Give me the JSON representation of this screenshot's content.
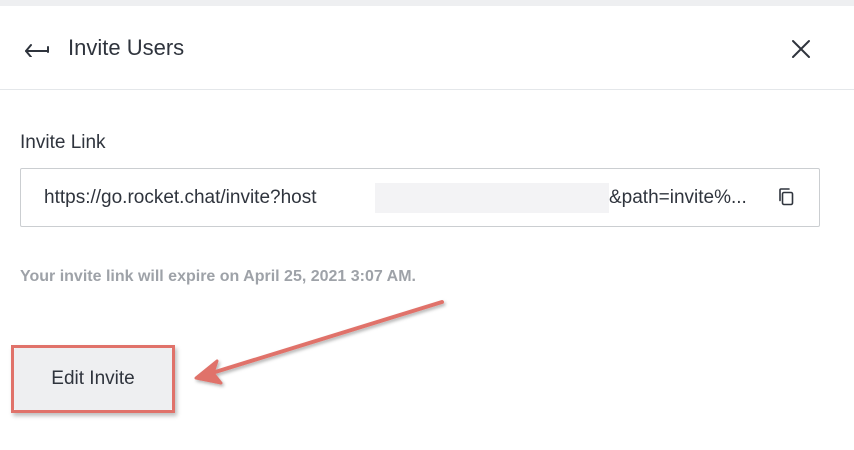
{
  "header": {
    "title": "Invite Users",
    "back_icon": "back-arrow-icon",
    "close_icon": "close-icon"
  },
  "invite_link": {
    "label": "Invite Link",
    "value_start": "https://go.rocket.chat/invite?host",
    "value_end": "&path=invite%...",
    "copy_icon": "copy-icon"
  },
  "expiry": {
    "text": "Your invite link will expire on April 25, 2021 3:07 AM."
  },
  "actions": {
    "edit_label": "Edit Invite"
  },
  "annotation": {
    "color": "#e0726a"
  }
}
